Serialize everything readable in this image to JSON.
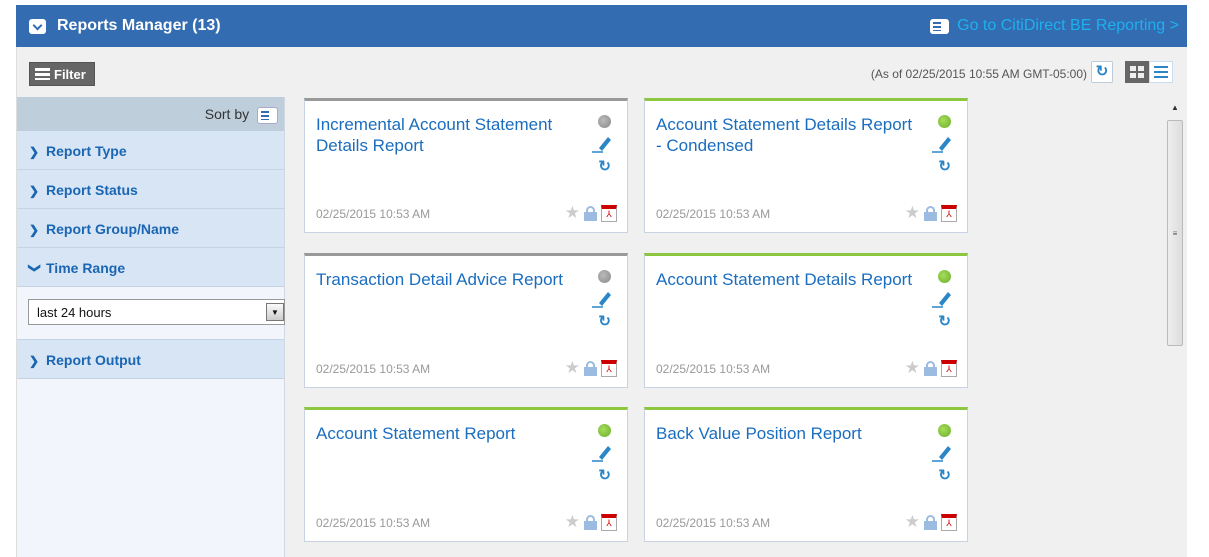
{
  "header": {
    "title": "Reports Manager (13)",
    "link": "Go to CitiDirect BE Reporting >"
  },
  "toolbar": {
    "filter": "Filter",
    "as_of": "(As of 02/25/2015 10:55 AM GMT-05:00)",
    "refresh_icon": "refresh-icon",
    "view": "grid"
  },
  "sidebar": {
    "sort_by": "Sort by",
    "sections": [
      {
        "label": "Report Type",
        "expanded": false
      },
      {
        "label": "Report Status",
        "expanded": false
      },
      {
        "label": "Report Group/Name",
        "expanded": false
      },
      {
        "label": "Time Range",
        "expanded": true
      },
      {
        "label": "Report Output",
        "expanded": false
      }
    ],
    "time_range_value": "last 24 hours"
  },
  "cards": [
    {
      "title": "Incremental Account Statement Details Report",
      "date": "02/25/2015 10:53 AM",
      "status": "gray"
    },
    {
      "title": "Account Statement Details Report - Condensed",
      "date": "02/25/2015 10:53 AM",
      "status": "green"
    },
    {
      "title": "Transaction Detail Advice Report",
      "date": "02/25/2015 10:53 AM",
      "status": "gray"
    },
    {
      "title": "Account Statement Details Report",
      "date": "02/25/2015 10:53 AM",
      "status": "green"
    },
    {
      "title": "Account Statement Report",
      "date": "02/25/2015 10:53 AM",
      "status": "green"
    },
    {
      "title": "Back Value Position Report",
      "date": "02/25/2015 10:53 AM",
      "status": "green"
    }
  ],
  "colors": {
    "header": "#336cb1",
    "link": "#1fb0ee",
    "title": "#1a6dbf",
    "ok": "#8dc63f"
  }
}
